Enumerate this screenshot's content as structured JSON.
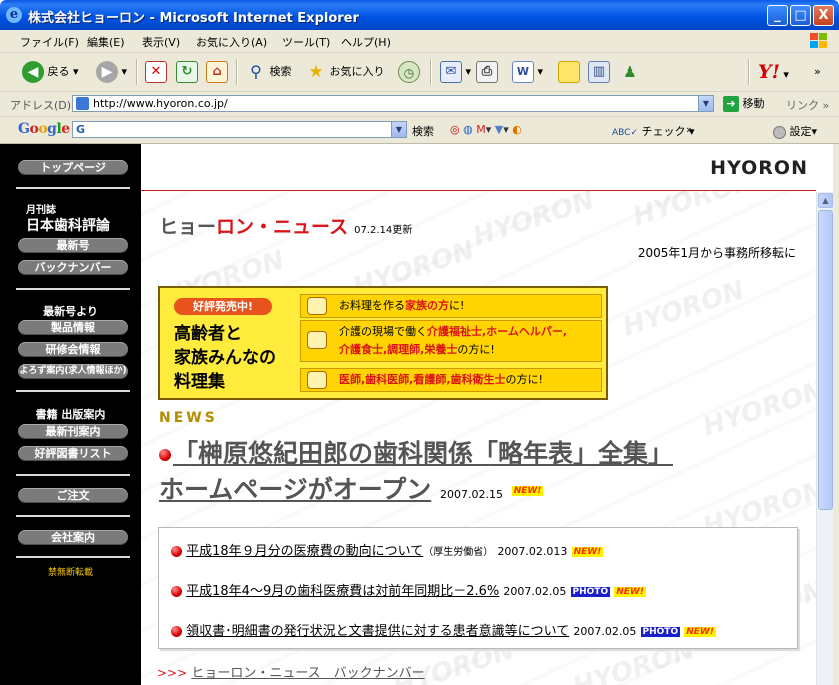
{
  "window": {
    "title": "株式会社ヒョーロン - Microsoft Internet Explorer",
    "minimize": "_",
    "maximize": "□",
    "close": "X"
  },
  "menu": [
    "ファイル(F)",
    "編集(E)",
    "表示(V)",
    "お気に入り(A)",
    "ツール(T)",
    "ヘルプ(H)"
  ],
  "toolbar": {
    "back": "戻る",
    "search": "検索",
    "favorites": "お気に入り",
    "yahoo": "Y!",
    "more": "»"
  },
  "address": {
    "label": "アドレス(D)",
    "url": "http://www.hyoron.co.jp/",
    "go": "移動",
    "links": "リンク",
    "more": "»"
  },
  "google": {
    "logo": "Google",
    "field": "G",
    "search": "検索",
    "check": "チェック",
    "settings": "設定",
    "more": "»"
  },
  "sidebar": {
    "top": "トップページ",
    "magazine_small": "月刊誌",
    "magazine_title": "日本歯科評論",
    "latest": "最新号",
    "back_numbers": "バックナンバー",
    "from_latest": "最新号より",
    "products": "製品情報",
    "seminars": "研修会情報",
    "jobs": "よろず案内(求人情報ほか)",
    "books": "書籍 出版案内",
    "new_books": "最新刊案内",
    "popular_books": "好評図書リスト",
    "order": "ご注文",
    "company": "会社案内",
    "no_repro": "禁無断転載"
  },
  "brand": "HYORON",
  "news_header": {
    "part1": "ヒョー",
    "part2": "ロン・ニュース",
    "updated": "07.2.14更新"
  },
  "moved_notice": "2005年1月から事務所移転に",
  "banner": {
    "badge": "好評発売中!",
    "title_lines": [
      "高齢者と",
      "家族みんなの",
      "料理集"
    ],
    "row1_pre": "お料理を作る",
    "row1_red": "家族の方",
    "row1_post": "に!",
    "row2_line1_pre": "介護の現場で働く",
    "row2_line1_red": "介護福祉士,ホームヘルパー,",
    "row2_line2_red": "介護食士,調理師,栄養士",
    "row2_line2_post": "の方に!",
    "row3_red": "医師,歯科医師,看護師,歯科衛生士",
    "row3_post": "の方に!"
  },
  "news_label": "NEWS",
  "headline": {
    "line1": "「榊原悠紀田郎の歯科関係「略年表」全集」",
    "line2": "ホームページがオープン",
    "date": "2007.02.15",
    "tag": "NEW!"
  },
  "news_items": [
    {
      "text": "平成18年９月分の医療費の動向について",
      "note": "（厚生労働省）",
      "date": "2007.02.013",
      "photo": "",
      "tag": "NEW!"
    },
    {
      "text": "平成18年4～9月の歯科医療費は対前年同期比－2.6%",
      "note": "",
      "date": "2007.02.05",
      "photo": "PHOTO",
      "tag": "NEW!"
    },
    {
      "text": "領収書･明細書の発行状況と文書提供に対する患者意識等について",
      "note": "",
      "date": "2007.02.05",
      "photo": "PHOTO",
      "tag": "NEW!"
    }
  ],
  "back_link": {
    "arrows": ">>>",
    "text": "ヒョーロン・ニュース　バックナンバー"
  }
}
